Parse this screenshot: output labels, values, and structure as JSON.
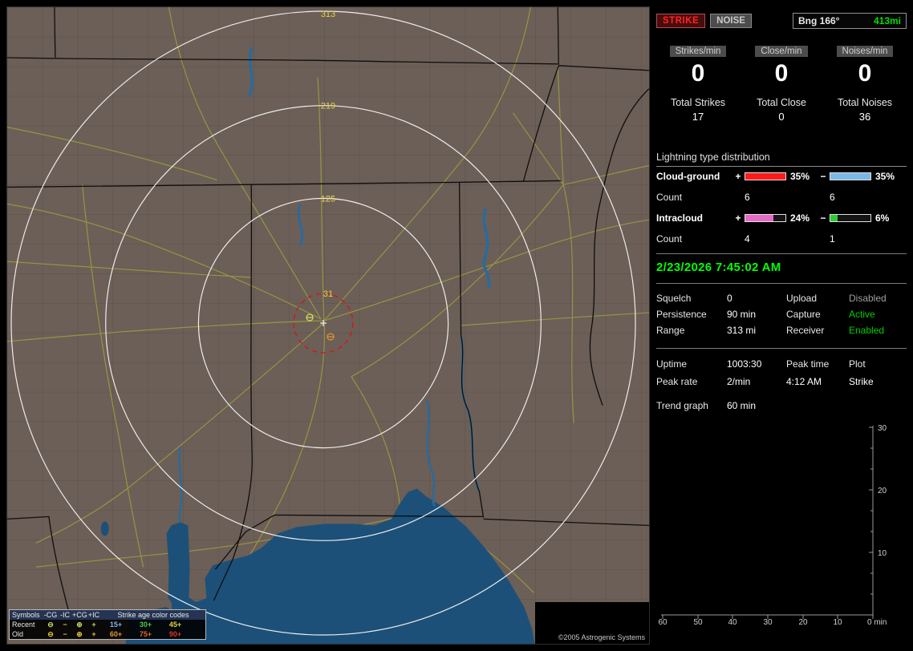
{
  "colors": {
    "accent_green": "#00e000",
    "datetime_green": "#00ff00",
    "strike_red": "#ff2424",
    "ring_label_yellow": "#e8d44e",
    "water_blue": "#1c5078",
    "road_yellow": "#9b9b42",
    "storm_circle_red": "#d81414"
  },
  "map": {
    "ring_labels": [
      "313",
      "219",
      "125",
      "31"
    ],
    "copyright": "©2005 Astrogenic Systems",
    "legend": {
      "symbols_header": "Symbols",
      "symbol_cols": [
        "-CG",
        "-IC",
        "+CG",
        "+IC"
      ],
      "age_header": "Strike age color codes",
      "rows": [
        {
          "label": "Recent",
          "symbols": [
            "⊖",
            "−",
            "⊕",
            "+"
          ],
          "ages": [
            {
              "text": "15+",
              "color": "#7fb3e8"
            },
            {
              "text": "30+",
              "color": "#4ec84e"
            },
            {
              "text": "45+",
              "color": "#e0d44a"
            }
          ]
        },
        {
          "label": "Old",
          "symbols": [
            "⊖",
            "−",
            "⊕",
            "+"
          ],
          "ages": [
            {
              "text": "60+",
              "color": "#e0992e"
            },
            {
              "text": "75+",
              "color": "#e0662a"
            },
            {
              "text": "90+",
              "color": "#e03228"
            }
          ]
        }
      ]
    }
  },
  "panel": {
    "strike_button": "STRIKE",
    "noise_button": "NOISE",
    "bearing": {
      "label": "Bng 166°",
      "distance": "413mi"
    },
    "counters": [
      {
        "rate_label": "Strikes/min",
        "rate": "0",
        "total_label": "Total Strikes",
        "total": "17"
      },
      {
        "rate_label": "Close/min",
        "rate": "0",
        "total_label": "Total Close",
        "total": "0"
      },
      {
        "rate_label": "Noises/min",
        "rate": "0",
        "total_label": "Total Noises",
        "total": "36"
      }
    ],
    "distribution": {
      "title": "Lightning type distribution",
      "rows": [
        {
          "name": "Cloud-ground",
          "plus": "+",
          "minus": "−",
          "pos_pct": "35%",
          "neg_pct": "35%",
          "pos_fill": 100,
          "neg_fill": 100,
          "pos_color": "#ff1a1a",
          "neg_color": "#7ab8e8",
          "count_label": "Count",
          "pos_count": "6",
          "neg_count": "6"
        },
        {
          "name": "Intracloud",
          "plus": "+",
          "minus": "−",
          "pos_pct": "24%",
          "neg_pct": "6%",
          "pos_fill": 69,
          "neg_fill": 17,
          "pos_color": "#e86ac8",
          "neg_color": "#2ecc2e",
          "count_label": "Count",
          "pos_count": "4",
          "neg_count": "1"
        }
      ]
    },
    "datetime": "2/23/2026 7:45:02 AM",
    "settings": [
      {
        "label": "Squelch",
        "value": "0"
      },
      {
        "label": "Persistence",
        "value": "90 min"
      },
      {
        "label": "Range",
        "value": "313 mi"
      }
    ],
    "statuses": [
      {
        "label": "Upload",
        "value": "Disabled",
        "color": "#a0a0a0"
      },
      {
        "label": "Capture",
        "value": "Active",
        "color": "#00d000"
      },
      {
        "label": "Receiver",
        "value": "Enabled",
        "color": "#00d000"
      }
    ],
    "stats": {
      "uptime_label": "Uptime",
      "uptime": "1003:30",
      "peak_time_label": "Peak time",
      "peak_time": "4:12 AM",
      "plot_label": "Plot",
      "plot_value": "Strike",
      "peak_rate_label": "Peak rate",
      "peak_rate": "2/min"
    },
    "trend": {
      "label": "Trend graph",
      "window": "60 min",
      "y_ticks": [
        "30",
        "20",
        "10"
      ],
      "x_ticks": [
        "60",
        "50",
        "40",
        "30",
        "20",
        "10"
      ],
      "x_last": "0 min"
    }
  }
}
